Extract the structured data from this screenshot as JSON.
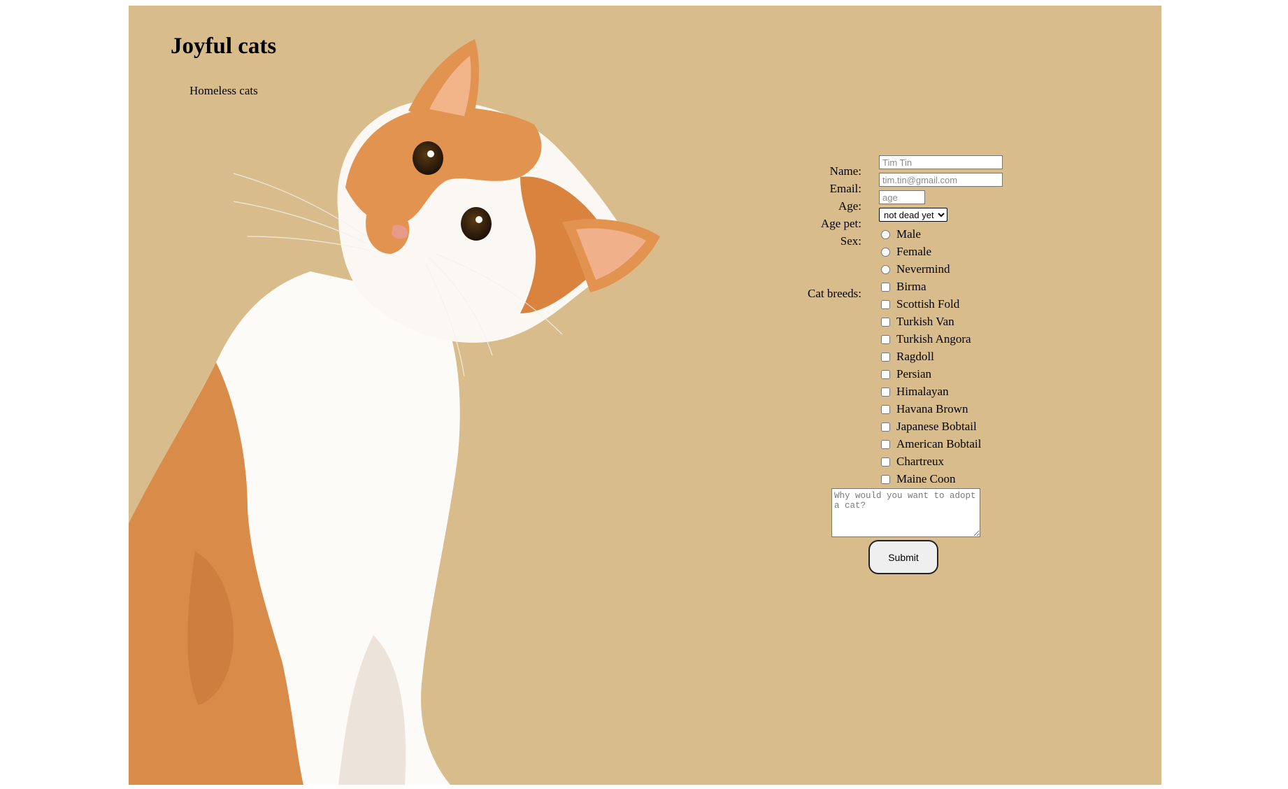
{
  "header": {
    "title": "Joyful cats",
    "subtitle": "Homeless cats"
  },
  "form": {
    "labels": {
      "name": "Name:",
      "email": "Email:",
      "age": "Age:",
      "age_pet": "Age pet:",
      "sex": "Sex:",
      "cat_breeds": "Cat breeds:"
    },
    "name_placeholder": "Tim Tin",
    "email_placeholder": "tim.tin@gmail.com",
    "age_placeholder": "age",
    "age_pet_selected": "not dead yet",
    "sex_options": [
      "Male",
      "Female",
      "Nevermind"
    ],
    "breeds": [
      "Birma",
      "Scottish Fold",
      "Turkish Van",
      "Turkish Angora",
      "Ragdoll",
      "Persian",
      "Himalayan",
      "Havana Brown",
      "Japanese Bobtail",
      "American Bobtail",
      "Chartreux",
      "Maine Coon"
    ],
    "why_placeholder": "Why would you want to adopt a cat?",
    "submit_label": "Submit"
  },
  "colors": {
    "background": "#d8bc8b",
    "page": "#ffffff"
  },
  "icons": {
    "hero": "cat-photo-icon",
    "select_arrow": "chevron-down-icon"
  }
}
